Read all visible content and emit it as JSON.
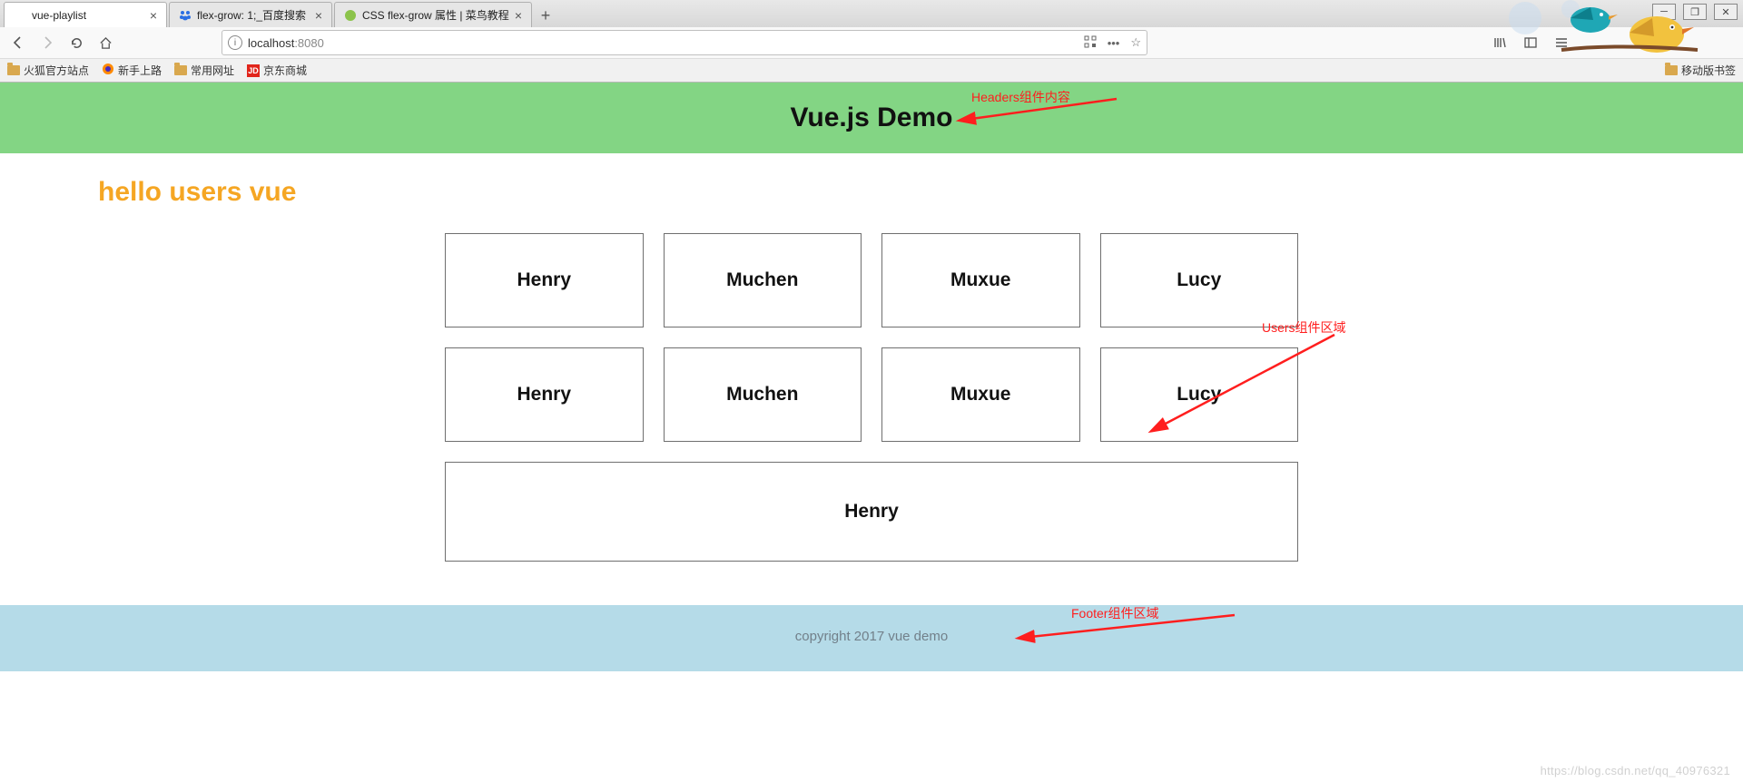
{
  "browser": {
    "tabs": [
      {
        "title": "vue-playlist",
        "active": true,
        "icon": ""
      },
      {
        "title": "flex-grow: 1;_百度搜索",
        "active": false,
        "icon": "paw"
      },
      {
        "title": "CSS flex-grow 属性 | 菜鸟教程",
        "active": false,
        "icon": "runoob"
      }
    ],
    "address_host": "localhost",
    "address_port": ":8080",
    "bookmarks": [
      "火狐官方站点",
      "新手上路",
      "常用网址",
      "京东商城"
    ],
    "mobile_bookmarks": "移动版书签"
  },
  "page": {
    "header_title": "Vue.js Demo",
    "users_heading": "hello users vue",
    "users_row1": [
      "Henry",
      "Muchen",
      "Muxue",
      "Lucy"
    ],
    "users_row2": [
      "Henry",
      "Muchen",
      "Muxue",
      "Lucy"
    ],
    "users_row3": [
      "Henry"
    ],
    "footer_text": "copyright 2017 vue demo"
  },
  "annotations": {
    "header": "Headers组件内容",
    "users": "Users组件区域",
    "footer": "Footer组件区域"
  },
  "watermark": "https://blog.csdn.net/qq_40976321"
}
